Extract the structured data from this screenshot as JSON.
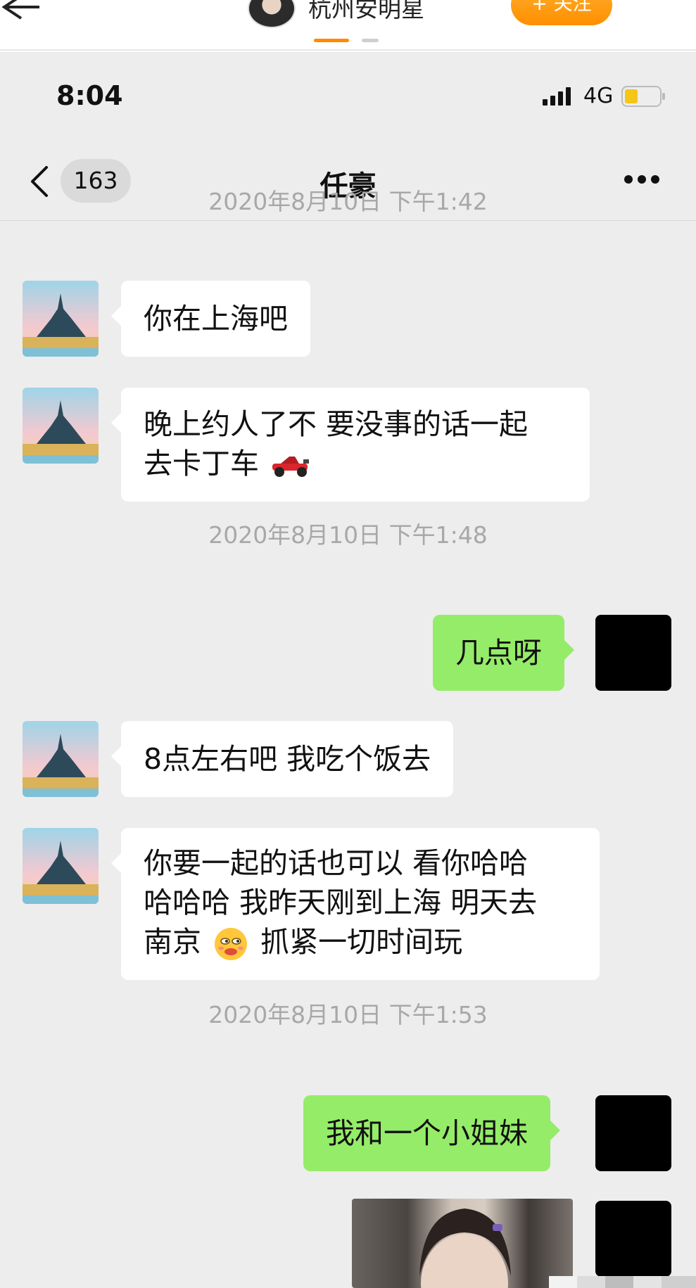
{
  "outer_header": {
    "account_name": "杭州安明星",
    "follow_label": "+ 关注"
  },
  "status_bar": {
    "time": "8:04",
    "network": "4G"
  },
  "chat_header": {
    "unread_count": "163",
    "title": "任豪"
  },
  "messages": {
    "ts1": "2020年8月10日 下午1:42",
    "m1": "你在上海吧",
    "m2_line1": "晚上约人了不 要没事的话一起",
    "m2_line2": "去卡丁车",
    "ts2": "2020年8月10日 下午1:48",
    "m3": "几点呀",
    "m4": "8点左右吧 我吃个饭去",
    "m5_line1": "你要一起的话也可以 看你哈哈",
    "m5_line2": "哈哈哈 我昨天刚到上海 明天去",
    "m5_line3a": "南京",
    "m5_line3b": "抓紧一切时间玩",
    "ts3": "2020年8月10日 下午1:53",
    "m6": "我和一个小姐妹"
  },
  "icons": {
    "race_car_emoji": "race-car-icon",
    "smirk_emoji": "smirk-emoji-icon"
  },
  "colors": {
    "outgoing_bubble": "#95ec69",
    "incoming_bubble": "#ffffff",
    "chat_background": "#ededed",
    "follow_button": "#ff8f00",
    "battery_level": "#f5c518"
  }
}
